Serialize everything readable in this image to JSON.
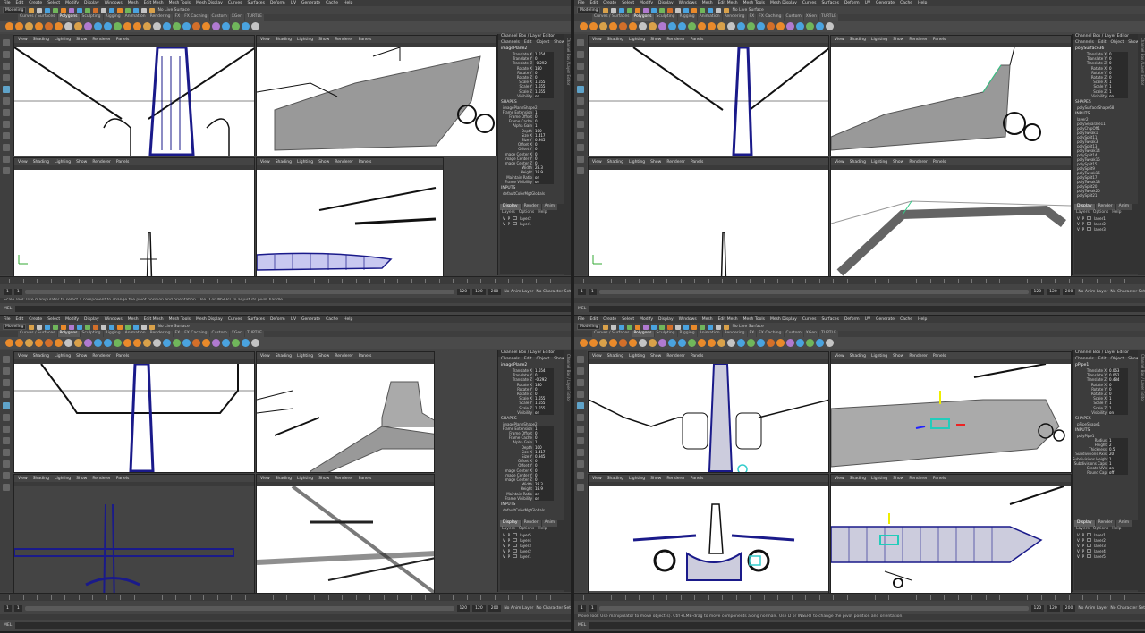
{
  "menus": [
    "File",
    "Edit",
    "Create",
    "Select",
    "Modify",
    "Display",
    "Windows",
    "Mesh",
    "Edit Mesh",
    "Mesh Tools",
    "Mesh Display",
    "Curves",
    "Surfaces",
    "Deform",
    "UV",
    "Generate",
    "Cache",
    "Help"
  ],
  "mode_set": "Modeling",
  "no_live_surface": "No Live Surface",
  "shelf_tabs": [
    "Curves / Surfaces",
    "Polygons",
    "Sculpting",
    "Rigging",
    "Animation",
    "Rendering",
    "FX",
    "FX Caching",
    "Custom",
    "XGen",
    "TURTLE"
  ],
  "active_shelf_tab": "Polygons",
  "panel_menu": [
    "View",
    "Shading",
    "Lighting",
    "Show",
    "Renderer",
    "Panels"
  ],
  "cb": {
    "header": "Channel Box / Layer Editor",
    "menu": [
      "Channels",
      "Edit",
      "Object",
      "Show"
    ],
    "shapes_label": "SHAPES",
    "inputs_label": "INPUTS"
  },
  "layer_tabs": [
    "Display",
    "Render",
    "Anim"
  ],
  "layer_menu": [
    "Layers",
    "Options",
    "Help"
  ],
  "time_range": {
    "start": "1",
    "current": "1",
    "anim_end": "120",
    "end": "120",
    "max": "200"
  },
  "no_anim_layer": "No Anim Layer",
  "no_char_set": "No Character Set",
  "mel_label": "MEL",
  "quads": [
    {
      "object": "imagePlane2",
      "attrs": [
        [
          "Translate X",
          "1.654"
        ],
        [
          "Translate Y",
          "0"
        ],
        [
          "Translate Z",
          "-0.292"
        ],
        [
          "Rotate X",
          "180"
        ],
        [
          "Rotate Y",
          "0"
        ],
        [
          "Rotate Z",
          "0"
        ],
        [
          "Scale X",
          "1.655"
        ],
        [
          "Scale Y",
          "1.655"
        ],
        [
          "Scale Z",
          "1.655"
        ],
        [
          "Visibility",
          "on"
        ]
      ],
      "shape": "imagePlaneShape2",
      "shape_attrs": [
        [
          "Frame Extension",
          "1"
        ],
        [
          "Frame Offset",
          "0"
        ],
        [
          "Frame Cache",
          "0"
        ],
        [
          "Alpha Gain",
          "1"
        ],
        [
          "Depth",
          "100"
        ],
        [
          "Size X",
          "1.417"
        ],
        [
          "Size Y",
          "0.945"
        ],
        [
          "Offset X",
          "0"
        ],
        [
          "Offset Y",
          "0"
        ],
        [
          "Image Center X",
          "0"
        ],
        [
          "Image Center Y",
          "0"
        ],
        [
          "Image Center Z",
          "0"
        ],
        [
          "Width",
          "28.3"
        ],
        [
          "Height",
          "18.9"
        ],
        [
          "Maintain Ratio",
          "on"
        ],
        [
          "Frame Visibility",
          "on"
        ]
      ],
      "input": "defaultColorMgtGlobals",
      "layers": [
        "layer2",
        "layer1"
      ],
      "help": "Scale Tool: Use manipulator to select a component to change the pivot position and orientation. Use D or INSERT to adjust its pivot handle."
    },
    {
      "object": "polySurface36",
      "attrs": [
        [
          "Translate X",
          "0"
        ],
        [
          "Translate Y",
          "0"
        ],
        [
          "Translate Z",
          "0"
        ],
        [
          "Rotate X",
          "0"
        ],
        [
          "Rotate Y",
          "0"
        ],
        [
          "Rotate Z",
          "0"
        ],
        [
          "Scale X",
          "1"
        ],
        [
          "Scale Y",
          "1"
        ],
        [
          "Scale Z",
          "1"
        ],
        [
          "Visibility",
          "on"
        ]
      ],
      "shape": "polySurfaceShape68",
      "shape_attrs": [],
      "input": "",
      "input_list": [
        "layer2",
        "polySeparate11",
        "polyChipOff1",
        "polyTweak1",
        "polySplit11",
        "polyTweak3",
        "polySplit13",
        "polyTweak14",
        "polySplit14",
        "polyTweak15",
        "polySplit15",
        "polySplit9",
        "polyTweak16",
        "polySplit17",
        "polyTweak18",
        "polySplit20",
        "polyTweak20",
        "polySplit21"
      ],
      "layers": [
        "layer1",
        "layer2",
        "layer3"
      ],
      "help": ""
    },
    {
      "object": "imagePlane2",
      "attrs": [
        [
          "Translate X",
          "1.654"
        ],
        [
          "Translate Y",
          "0"
        ],
        [
          "Translate Z",
          "-0.292"
        ],
        [
          "Rotate X",
          "180"
        ],
        [
          "Rotate Y",
          "0"
        ],
        [
          "Rotate Z",
          "0"
        ],
        [
          "Scale X",
          "1.655"
        ],
        [
          "Scale Y",
          "1.655"
        ],
        [
          "Scale Z",
          "1.655"
        ],
        [
          "Visibility",
          "on"
        ]
      ],
      "shape": "imagePlaneShape2",
      "shape_attrs": [
        [
          "Frame Extension",
          "1"
        ],
        [
          "Frame Offset",
          "0"
        ],
        [
          "Frame Cache",
          "0"
        ],
        [
          "Alpha Gain",
          "1"
        ],
        [
          "Depth",
          "100"
        ],
        [
          "Size X",
          "1.417"
        ],
        [
          "Size Y",
          "0.945"
        ],
        [
          "Offset X",
          "0"
        ],
        [
          "Offset Y",
          "0"
        ],
        [
          "Image Center X",
          "0"
        ],
        [
          "Image Center Y",
          "0"
        ],
        [
          "Image Center Z",
          "0"
        ],
        [
          "Width",
          "28.3"
        ],
        [
          "Height",
          "18.9"
        ],
        [
          "Maintain Ratio",
          "on"
        ],
        [
          "Frame Visibility",
          "on"
        ]
      ],
      "input": "defaultColorMgtGlobals",
      "layers": [
        "layer5",
        "layer4",
        "layer3",
        "layer2",
        "layer1"
      ],
      "help": ""
    },
    {
      "object": "pPipe1",
      "attrs": [
        [
          "Translate X",
          "0.063"
        ],
        [
          "Translate Y",
          "0.062"
        ],
        [
          "Translate Z",
          "0.484"
        ],
        [
          "Rotate X",
          "0"
        ],
        [
          "Rotate Y",
          "0"
        ],
        [
          "Rotate Z",
          "0"
        ],
        [
          "Scale X",
          "1"
        ],
        [
          "Scale Y",
          "1"
        ],
        [
          "Scale Z",
          "1"
        ],
        [
          "Visibility",
          "on"
        ]
      ],
      "shape": "pPipeShape1",
      "shape_attrs": [],
      "input": "polyPipe1",
      "input_attrs": [
        [
          "Radius",
          "1"
        ],
        [
          "Height",
          "2"
        ],
        [
          "Thickness",
          "0.5"
        ],
        [
          "Subdivisions Axis",
          "20"
        ],
        [
          "Subdivisions Height",
          "1"
        ],
        [
          "Subdivisions Caps",
          "1"
        ],
        [
          "Create UVs",
          "on"
        ],
        [
          "Round Cap",
          "off"
        ]
      ],
      "layers": [
        "layer1",
        "layer2",
        "layer3",
        "layer4",
        "layer5"
      ],
      "help": "Move Tool: Use manipulator to move object(s). Ctrl+LMB-drag to move components along normals. Use D or INSERT to change the pivot position and orientation."
    }
  ]
}
